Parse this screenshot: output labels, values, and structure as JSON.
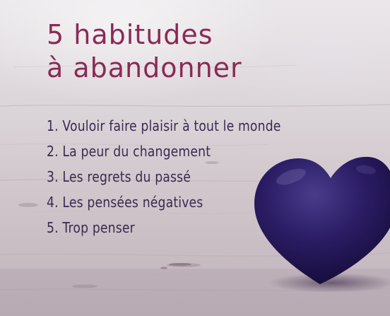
{
  "title": {
    "line1": "5 habitudes",
    "line2": "à abandonner"
  },
  "habits": [
    "1. Vouloir faire plaisir à tout le monde",
    "2. La peur du changement",
    "3. Les regrets du passé",
    "4. Les pensées négatives",
    "5. Trop penser"
  ],
  "colors": {
    "title": "#8a2a55",
    "text": "#3a2a50",
    "heart": "#2a1a5e",
    "background": "#ddd6da"
  },
  "icons": {
    "heart": "heart-icon"
  }
}
